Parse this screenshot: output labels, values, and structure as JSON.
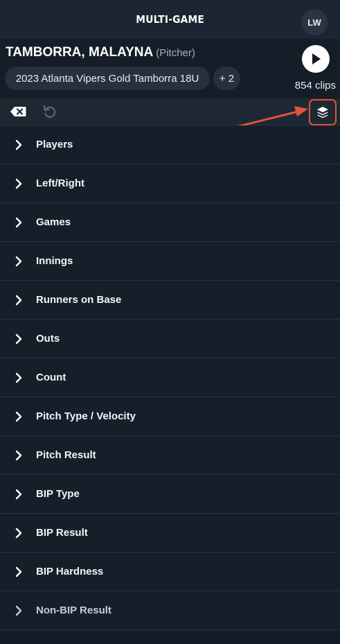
{
  "topbar": {
    "title": "MULTI-GAME",
    "avatar_initials": "LW"
  },
  "header": {
    "player_name": "TAMBORRA, MALAYNA",
    "player_role": "(Pitcher)",
    "team_chip": "2023 Atlanta Vipers Gold Tamborra 18U",
    "more_chip": "+ 2",
    "play_icon": "play-icon",
    "clips_count": "854 clips"
  },
  "toolbar": {
    "clear_icon": "backspace-icon",
    "undo_icon": "undo-icon",
    "layers_icon": "layers-icon"
  },
  "filters": [
    {
      "label": "Players"
    },
    {
      "label": "Left/Right"
    },
    {
      "label": "Games"
    },
    {
      "label": "Innings"
    },
    {
      "label": "Runners on Base"
    },
    {
      "label": "Outs"
    },
    {
      "label": "Count"
    },
    {
      "label": "Pitch Type / Velocity"
    },
    {
      "label": "Pitch Result"
    },
    {
      "label": "BIP Type"
    },
    {
      "label": "BIP Result"
    },
    {
      "label": "BIP Hardness"
    },
    {
      "label": "Non-BIP Result"
    }
  ],
  "colors": {
    "background": "#141e29",
    "annotation": "#e0543d",
    "chip": "#26313d"
  }
}
